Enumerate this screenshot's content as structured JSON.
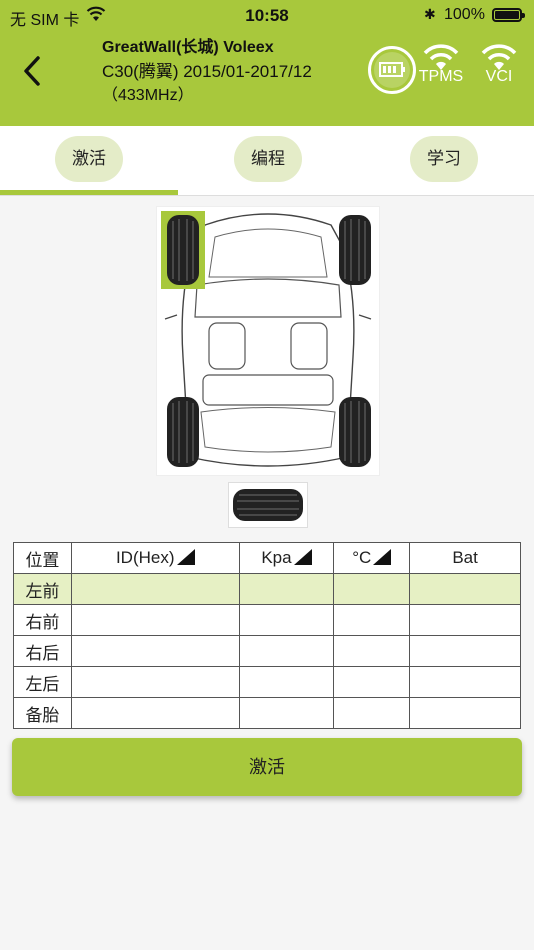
{
  "status": {
    "carrier": "无 SIM 卡",
    "time": "10:58",
    "bluetooth_icon": "bluetooth-icon",
    "battery_pct": "100%"
  },
  "header": {
    "back_icon": "chevron-left-icon",
    "title_line1": "GreatWall(长城) Voleex",
    "title_line2": "C30(腾翼) 2015/01-2017/12",
    "title_line3": "（433MHz）",
    "battery_indicator_icon": "battery-icon",
    "tpms_label": "TPMS",
    "vci_label": "VCI",
    "accent_color": "#a8c83c"
  },
  "tabs": [
    {
      "label": "激活"
    },
    {
      "label": "编程"
    },
    {
      "label": "学习"
    }
  ],
  "table": {
    "headers": [
      "位置",
      "ID(Hex)",
      "Kpa",
      "°C",
      "Bat"
    ],
    "rows": [
      {
        "position": "左前",
        "id": "",
        "kpa": "",
        "temp": "",
        "bat": ""
      },
      {
        "position": "右前",
        "id": "",
        "kpa": "",
        "temp": "",
        "bat": ""
      },
      {
        "position": "右后",
        "id": "",
        "kpa": "",
        "temp": "",
        "bat": ""
      },
      {
        "position": "左后",
        "id": "",
        "kpa": "",
        "temp": "",
        "bat": ""
      },
      {
        "position": "备胎",
        "id": "",
        "kpa": "",
        "temp": "",
        "bat": ""
      }
    ]
  },
  "action": {
    "activate_label": "激活"
  }
}
